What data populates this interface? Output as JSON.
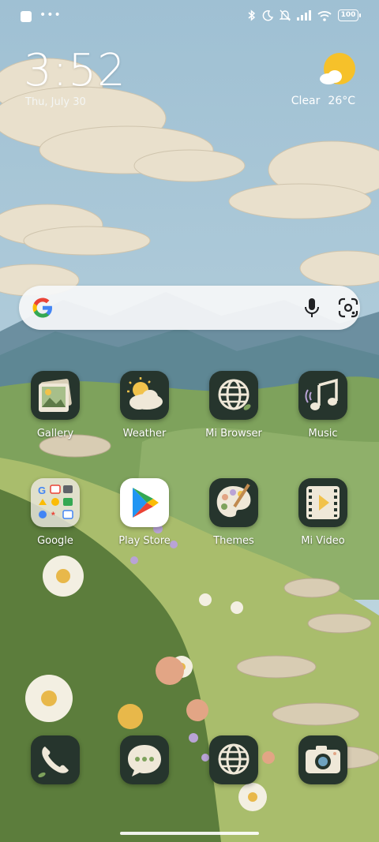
{
  "status_bar": {
    "battery": "100"
  },
  "lockscreen": {
    "time": "3:52",
    "date": "Thu, July 30"
  },
  "weather": {
    "condition": "Clear",
    "temperature": "26°C",
    "icon": "sun-cloud-icon"
  },
  "search": {
    "placeholder": ""
  },
  "apps": [
    {
      "label": "Gallery",
      "icon": "gallery-icon"
    },
    {
      "label": "Weather",
      "icon": "weather-icon"
    },
    {
      "label": "Mi Browser",
      "icon": "globe-icon"
    },
    {
      "label": "Music",
      "icon": "music-note-icon"
    },
    {
      "label": "Google",
      "icon": "google-folder-icon"
    },
    {
      "label": "Play Store",
      "icon": "play-store-icon"
    },
    {
      "label": "Themes",
      "icon": "palette-icon"
    },
    {
      "label": "Mi Video",
      "icon": "film-play-icon"
    }
  ],
  "dock": [
    {
      "label": "Phone",
      "icon": "phone-icon"
    },
    {
      "label": "Messaging",
      "icon": "message-bubble-icon"
    },
    {
      "label": "Browser",
      "icon": "globe-icon"
    },
    {
      "label": "Camera",
      "icon": "camera-icon"
    }
  ],
  "colors": {
    "sky": "#a9c8d9",
    "icon_bg": "#26352d",
    "icon_cream": "#efe8d8",
    "sun": "#f6c12a"
  }
}
